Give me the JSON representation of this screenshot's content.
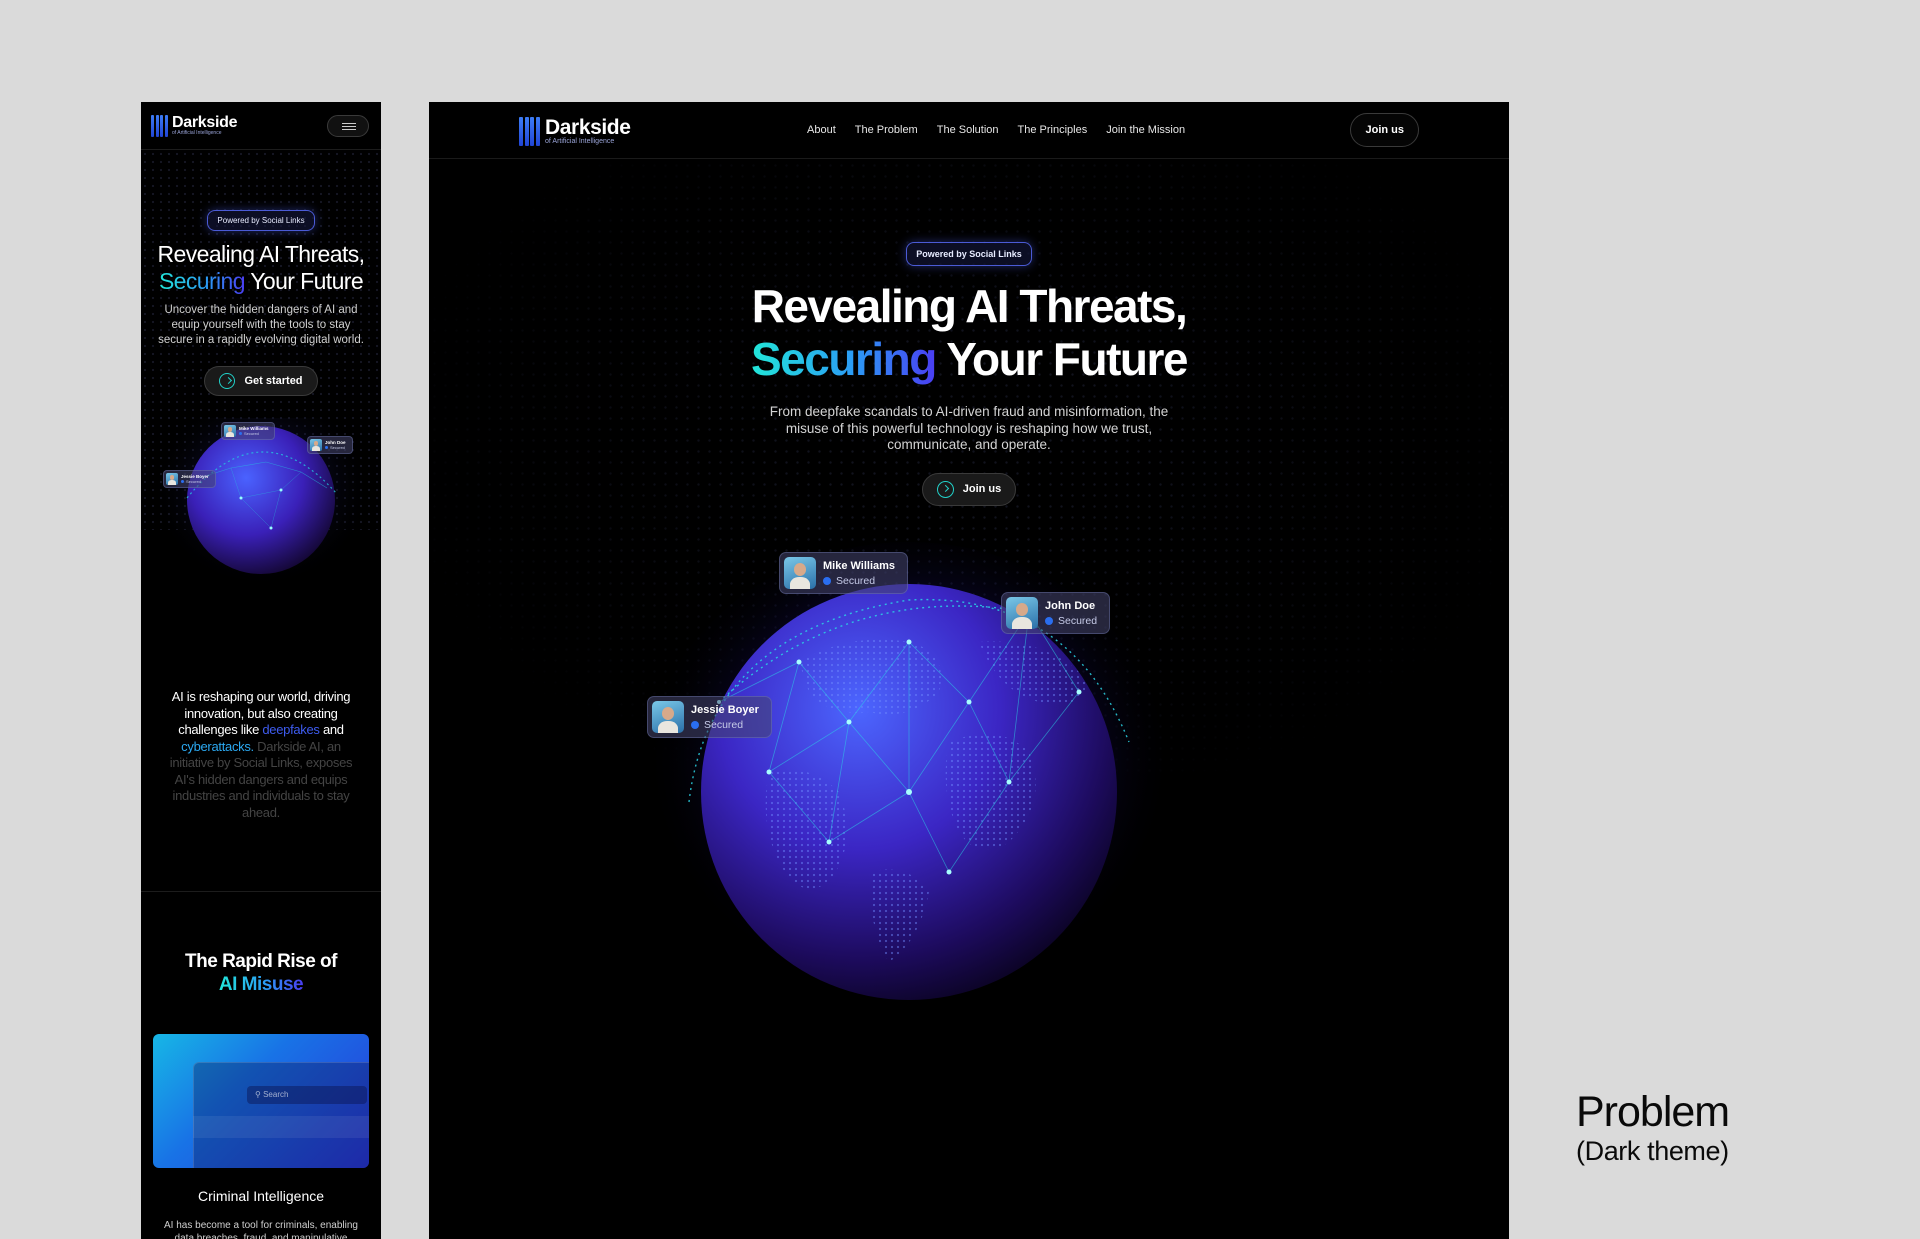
{
  "brand": {
    "name": "Darkside",
    "tagline": "of Artificial Intelligence"
  },
  "desktop": {
    "nav": {
      "links": [
        {
          "label": "About"
        },
        {
          "label": "The Problem"
        },
        {
          "label": "The Solution"
        },
        {
          "label": "The Principles"
        },
        {
          "label": "Join the Mission"
        }
      ],
      "cta_label": "Join us"
    },
    "hero": {
      "badge": "Powered by Social Links",
      "title_line1": "Revealing AI Threats,",
      "title_accent": "Securing",
      "title_rest": " Your Future",
      "subtitle": "From deepfake scandals to AI-driven fraud and misinformation, the misuse of this powerful technology is reshaping how we trust, communicate, and operate.",
      "button_label": "Join us"
    },
    "globe_tags": [
      {
        "name": "Mike Williams",
        "status": "Secured"
      },
      {
        "name": "John Doe",
        "status": "Secured"
      },
      {
        "name": "Jessie Boyer",
        "status": "Secured"
      }
    ]
  },
  "mobile": {
    "hero": {
      "badge": "Powered by Social Links",
      "title_line1": "Revealing AI Threats,",
      "title_accent": "Securing",
      "title_rest": " Your Future",
      "subtitle": "Uncover the hidden dangers of AI and equip yourself with the tools to stay secure in a rapidly evolving digital world.",
      "button_label": "Get started"
    },
    "globe_tags": [
      {
        "name": "Mike Williams",
        "status": "Secured"
      },
      {
        "name": "John Doe",
        "status": "Secured"
      },
      {
        "name": "Jessie Boyer",
        "status": "Secured"
      }
    ],
    "intro": {
      "part1": "AI is reshaping our world, driving innovation, but also creating challenges like ",
      "highlight1": "deepfakes",
      "part2": " and ",
      "highlight2": "cyberattacks",
      "part3": ".",
      "dim": " Darkside AI, an initiative by Social Links, exposes AI's hidden dangers and equips industries and individuals to stay ahead."
    },
    "section": {
      "title_line1": "The Rapid Rise of",
      "title_accent": "AI Misuse"
    },
    "card": {
      "search_placeholder": "Search",
      "title": "Criminal Intelligence",
      "description": "AI has become a tool for criminals, enabling data breaches, fraud, and manipulative"
    }
  },
  "caption": {
    "title": "Problem",
    "subtitle": "(Dark theme)"
  },
  "colors": {
    "accent_cyan": "#22e6d9",
    "accent_blue": "#3e5cf0",
    "page_background": "#dadada",
    "frame_background": "#000000"
  },
  "icons": [
    "logo-bars-icon",
    "menu-icon",
    "arrow-circle-icon",
    "globe-graphic",
    "search-icon",
    "verified-dot-icon"
  ]
}
